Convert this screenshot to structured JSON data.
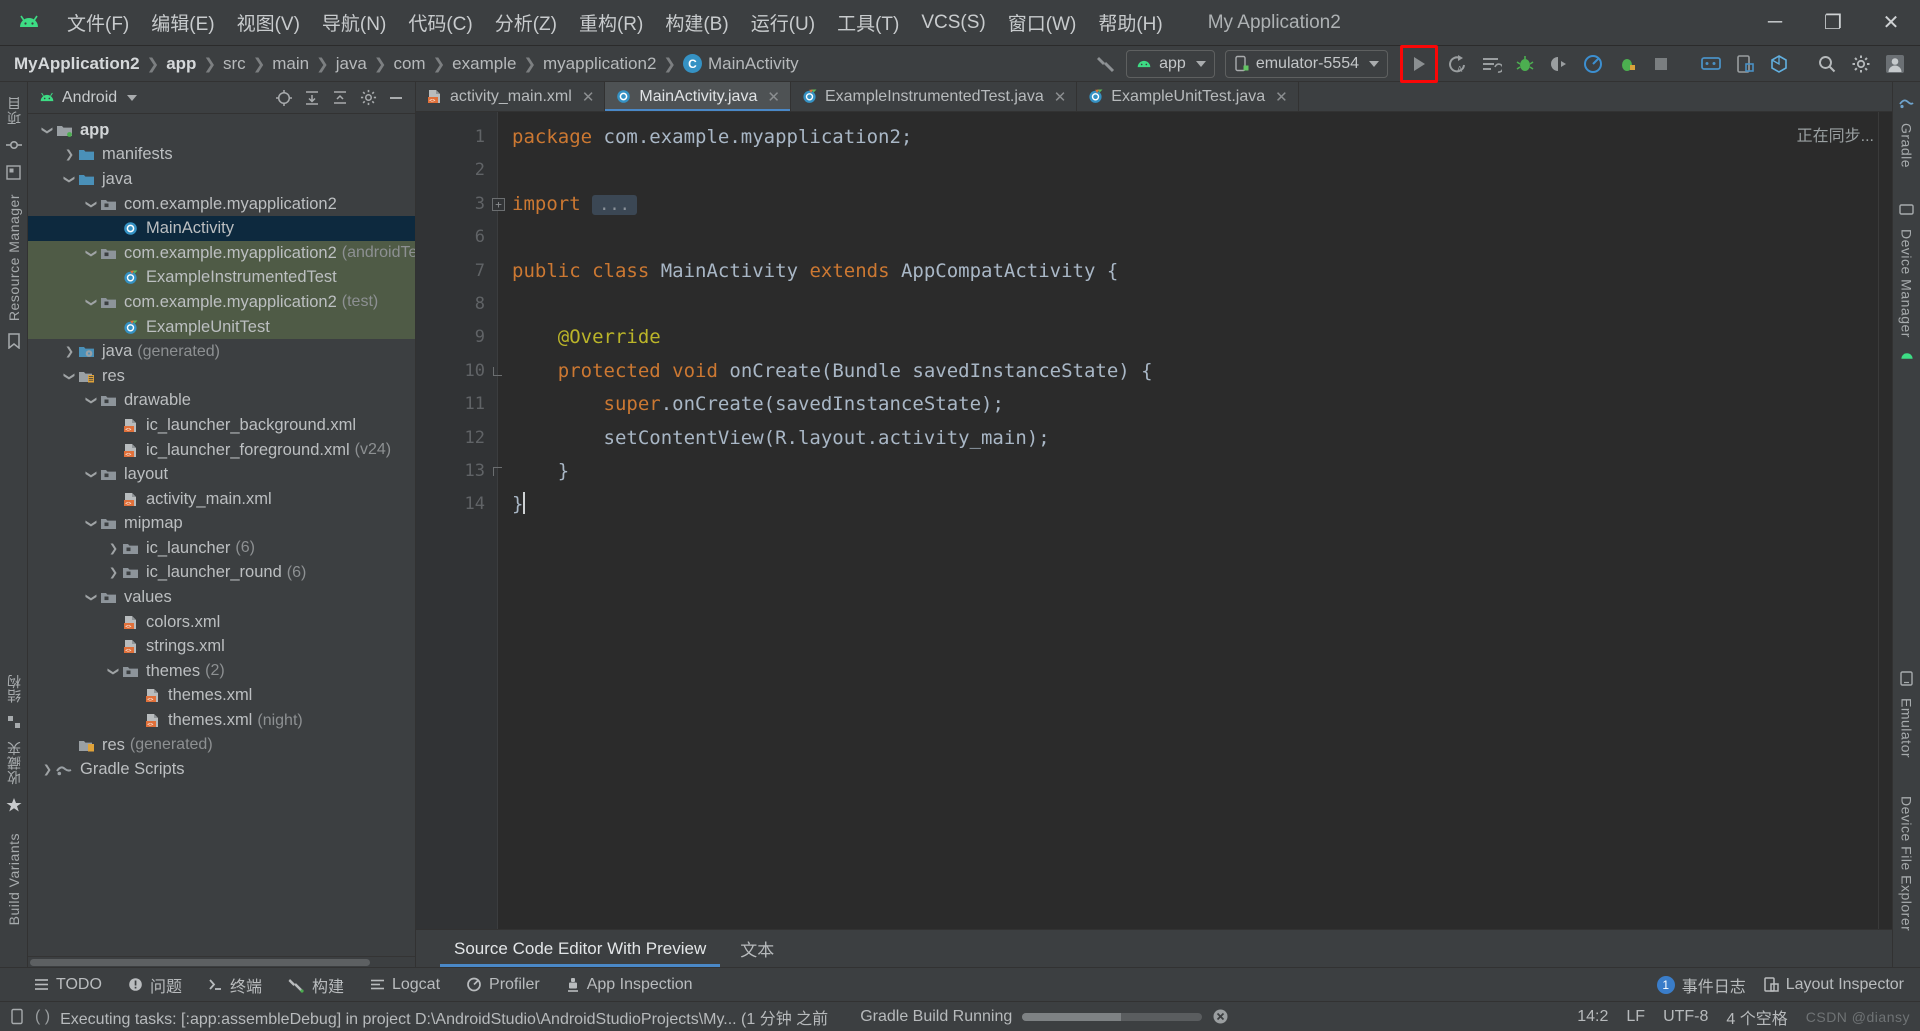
{
  "window": {
    "app_title": "My Application2",
    "controls": {
      "minimize": "─",
      "maximize": "❐",
      "close": "✕"
    }
  },
  "menubar": {
    "logo": "android-studio-logo-icon",
    "items": [
      {
        "label": "文件(F)",
        "name": "menu-file"
      },
      {
        "label": "编辑(E)",
        "name": "menu-edit"
      },
      {
        "label": "视图(V)",
        "name": "menu-view"
      },
      {
        "label": "导航(N)",
        "name": "menu-navigate"
      },
      {
        "label": "代码(C)",
        "name": "menu-code"
      },
      {
        "label": "分析(Z)",
        "name": "menu-analyze"
      },
      {
        "label": "重构(R)",
        "name": "menu-refactor"
      },
      {
        "label": "构建(B)",
        "name": "menu-build"
      },
      {
        "label": "运行(U)",
        "name": "menu-run"
      },
      {
        "label": "工具(T)",
        "name": "menu-tools"
      },
      {
        "label": "VCS(S)",
        "name": "menu-vcs"
      },
      {
        "label": "窗口(W)",
        "name": "menu-window"
      },
      {
        "label": "帮助(H)",
        "name": "menu-help"
      }
    ]
  },
  "navbar": {
    "breadcrumbs": [
      {
        "label": "MyApplication2",
        "style": "root"
      },
      {
        "label": "app",
        "style": "bold"
      },
      {
        "label": "src",
        "style": "normal"
      },
      {
        "label": "main",
        "style": "normal"
      },
      {
        "label": "java",
        "style": "normal"
      },
      {
        "label": "com",
        "style": "normal"
      },
      {
        "label": "example",
        "style": "normal"
      },
      {
        "label": "myapplication2",
        "style": "normal"
      }
    ],
    "current_class": {
      "badge": "C",
      "label": "MainActivity"
    },
    "run_config": {
      "label": "app",
      "icon": "android-head-icon"
    },
    "device": {
      "label": "emulator-5554",
      "icon": "device-phone-icon"
    },
    "run_button": {
      "name": "run-button",
      "icon": "play-triangle-icon",
      "highlight_color": "#fb0707"
    },
    "toolbar_icons": [
      {
        "name": "apply-changes-icon",
        "glyph": "Cₐ"
      },
      {
        "name": "apply-code-changes-icon",
        "glyph": "≡"
      },
      {
        "name": "debug-icon",
        "glyph": "bug"
      },
      {
        "name": "attach-debugger-icon",
        "glyph": "◑"
      },
      {
        "name": "profiler-icon",
        "glyph": "◔"
      },
      {
        "name": "run-with-coverage-icon",
        "glyph": "⚙"
      },
      {
        "name": "stop-icon",
        "glyph": "■"
      },
      {
        "name": "device-manager-icon",
        "glyph": "▭"
      },
      {
        "name": "layout-inspector-icon",
        "glyph": "◫"
      },
      {
        "name": "sdk-manager-icon",
        "glyph": "⬡"
      },
      {
        "name": "search-everywhere-icon",
        "glyph": "⚲"
      },
      {
        "name": "settings-gear-icon",
        "glyph": "⚙"
      },
      {
        "name": "avatar-icon",
        "glyph": "▣"
      }
    ]
  },
  "left_rail": {
    "items": [
      {
        "label": "项目",
        "name": "rail-project"
      },
      {
        "label": "",
        "name": "rail-commit-icon"
      },
      {
        "label": "结构",
        "name": "rail-structure"
      },
      {
        "label": "收藏夹",
        "name": "rail-favorites"
      },
      {
        "label": "Build Variants",
        "name": "rail-build-variants"
      }
    ]
  },
  "right_rail": {
    "items": [
      {
        "label": "Gradle",
        "name": "rail-gradle"
      },
      {
        "label": "Device Manager",
        "name": "rail-device-manager"
      },
      {
        "label": "Emulator",
        "name": "rail-emulator"
      },
      {
        "label": "Device File Explorer",
        "name": "rail-device-file-explorer"
      }
    ]
  },
  "project_panel": {
    "title": "Android",
    "header_icons": [
      {
        "name": "select-opened-file-icon",
        "glyph": "⊕"
      },
      {
        "name": "expand-all-icon",
        "glyph": "⤓"
      },
      {
        "name": "collapse-all-icon",
        "glyph": "⤒"
      },
      {
        "name": "settings-gear-icon",
        "glyph": "⚙"
      },
      {
        "name": "hide-panel-icon",
        "glyph": "─"
      }
    ],
    "tree": [
      {
        "label": "app",
        "indent": 0,
        "twist": "down",
        "icon": "module-folder-icon",
        "bold": true,
        "state": "normal"
      },
      {
        "label": "manifests",
        "indent": 1,
        "twist": "right",
        "icon": "folder-blue-icon",
        "state": "normal"
      },
      {
        "label": "java",
        "indent": 1,
        "twist": "down",
        "icon": "folder-blue-icon",
        "state": "normal"
      },
      {
        "label": "com.example.myapplication2",
        "indent": 2,
        "twist": "down",
        "icon": "package-folder-icon",
        "state": "normal"
      },
      {
        "label": "MainActivity",
        "indent": 3,
        "twist": "none",
        "icon": "java-class-icon",
        "state": "selected"
      },
      {
        "label": "com.example.myapplication2",
        "suffix": "(androidTest)",
        "indent": 2,
        "twist": "down",
        "icon": "package-folder-icon",
        "state": "test"
      },
      {
        "label": "ExampleInstrumentedTest",
        "indent": 3,
        "twist": "none",
        "icon": "java-test-class-icon",
        "state": "test"
      },
      {
        "label": "com.example.myapplication2",
        "suffix": "(test)",
        "indent": 2,
        "twist": "down",
        "icon": "package-folder-icon",
        "state": "test"
      },
      {
        "label": "ExampleUnitTest",
        "indent": 3,
        "twist": "none",
        "icon": "java-test-class-icon",
        "state": "test"
      },
      {
        "label": "java",
        "suffix": "(generated)",
        "indent": 1,
        "twist": "right",
        "icon": "folder-generated-icon",
        "state": "normal"
      },
      {
        "label": "res",
        "indent": 1,
        "twist": "down",
        "icon": "res-folder-icon",
        "state": "normal"
      },
      {
        "label": "drawable",
        "indent": 2,
        "twist": "down",
        "icon": "package-folder-icon",
        "state": "normal"
      },
      {
        "label": "ic_launcher_background.xml",
        "indent": 3,
        "twist": "none",
        "icon": "xml-file-icon",
        "state": "normal"
      },
      {
        "label": "ic_launcher_foreground.xml",
        "suffix": "(v24)",
        "indent": 3,
        "twist": "none",
        "icon": "xml-file-icon",
        "state": "normal"
      },
      {
        "label": "layout",
        "indent": 2,
        "twist": "down",
        "icon": "package-folder-icon",
        "state": "normal"
      },
      {
        "label": "activity_main.xml",
        "indent": 3,
        "twist": "none",
        "icon": "xml-file-icon",
        "state": "normal"
      },
      {
        "label": "mipmap",
        "indent": 2,
        "twist": "down",
        "icon": "package-folder-icon",
        "state": "normal"
      },
      {
        "label": "ic_launcher",
        "suffix": "(6)",
        "indent": 3,
        "twist": "right",
        "icon": "package-folder-icon",
        "state": "normal"
      },
      {
        "label": "ic_launcher_round",
        "suffix": "(6)",
        "indent": 3,
        "twist": "right",
        "icon": "package-folder-icon",
        "state": "normal"
      },
      {
        "label": "values",
        "indent": 2,
        "twist": "down",
        "icon": "package-folder-icon",
        "state": "normal"
      },
      {
        "label": "colors.xml",
        "indent": 3,
        "twist": "none",
        "icon": "xml-file-icon",
        "state": "normal"
      },
      {
        "label": "strings.xml",
        "indent": 3,
        "twist": "none",
        "icon": "xml-file-icon",
        "state": "normal"
      },
      {
        "label": "themes",
        "suffix": "(2)",
        "indent": 3,
        "twist": "down",
        "icon": "package-folder-icon",
        "state": "normal"
      },
      {
        "label": "themes.xml",
        "indent": 4,
        "twist": "none",
        "icon": "xml-file-icon",
        "state": "normal"
      },
      {
        "label": "themes.xml",
        "suffix": "(night)",
        "indent": 4,
        "twist": "none",
        "icon": "xml-file-icon",
        "state": "normal"
      },
      {
        "label": "res",
        "suffix": "(generated)",
        "indent": 1,
        "twist": "none",
        "icon": "res-generated-icon",
        "state": "normal"
      },
      {
        "label": "Gradle Scripts",
        "indent": 0,
        "twist": "right",
        "icon": "gradle-icon",
        "state": "normal"
      }
    ]
  },
  "editor": {
    "tabs": [
      {
        "label": "activity_main.xml",
        "icon": "xml-file-icon",
        "active": false,
        "closable": true
      },
      {
        "label": "MainActivity.java",
        "icon": "java-class-icon",
        "active": true,
        "closable": true
      },
      {
        "label": "ExampleInstrumentedTest.java",
        "icon": "java-test-class-icon",
        "active": false,
        "closable": true
      },
      {
        "label": "ExampleUnitTest.java",
        "icon": "java-test-class-icon",
        "active": false,
        "closable": true
      }
    ],
    "sync_status": "正在同步...",
    "line_numbers": [
      "1",
      "2",
      "3",
      "6",
      "7",
      "8",
      "9",
      "10",
      "11",
      "12",
      "13",
      "14"
    ],
    "code_lines": [
      {
        "n": "1",
        "html": "<span class='kw'>package</span> com.example.myapplication2;"
      },
      {
        "n": "2",
        "html": ""
      },
      {
        "n": "3",
        "html": "<span class='kw'>import</span> <span class='fold-ellipsis'>...</span>"
      },
      {
        "n": "6",
        "html": ""
      },
      {
        "n": "7",
        "html": "<span class='kw'>public</span> <span class='kw'>class</span> MainActivity <span class='kw'>extends</span> AppCompatActivity {"
      },
      {
        "n": "8",
        "html": ""
      },
      {
        "n": "9",
        "html": "    <span class='anno'>@Override</span>"
      },
      {
        "n": "10",
        "html": "    <span class='kw'>protected</span> <span class='kw'>void</span> onCreate(Bundle savedInstanceState) {"
      },
      {
        "n": "11",
        "html": "        <span class='kw'>super</span>.onCreate(savedInstanceState);"
      },
      {
        "n": "12",
        "html": "        setContentView(R.layout.activity_main);"
      },
      {
        "n": "13",
        "html": "    }"
      },
      {
        "n": "14",
        "html": "}"
      }
    ],
    "bottom_tabs": [
      {
        "label": "Source Code Editor With Preview",
        "active": true
      },
      {
        "label": "文本",
        "active": false
      }
    ]
  },
  "toolstrip": {
    "items": [
      {
        "label": "TODO",
        "name": "tool-todo",
        "icon": "list-icon"
      },
      {
        "label": "问题",
        "name": "tool-problems",
        "icon": "warning-icon"
      },
      {
        "label": "终端",
        "name": "tool-terminal",
        "icon": "terminal-icon"
      },
      {
        "label": "构建",
        "name": "tool-build",
        "icon": "hammer-icon"
      },
      {
        "label": "Logcat",
        "name": "tool-logcat",
        "icon": "logcat-icon"
      },
      {
        "label": "Profiler",
        "name": "tool-profiler",
        "icon": "profiler-icon"
      },
      {
        "label": "App Inspection",
        "name": "tool-app-inspection",
        "icon": "inspection-icon"
      }
    ],
    "right": [
      {
        "label": "事件日志",
        "name": "tool-event-log",
        "badge": "1"
      },
      {
        "label": "Layout Inspector",
        "name": "tool-layout-inspector",
        "icon": "layout-inspector-icon"
      }
    ]
  },
  "statusbar": {
    "message": "Executing tasks: [:app:assembleDebug] in project D:\\AndroidStudio\\AndroidStudioProjects\\My... (1 分钟 之前",
    "build_status": "Gradle Build Running",
    "progress_percent": 55,
    "cursor_position": "14:2",
    "line_separator": "LF",
    "encoding": "UTF-8",
    "indent": "4 个空格",
    "watermark": "CSDN @diansy"
  }
}
